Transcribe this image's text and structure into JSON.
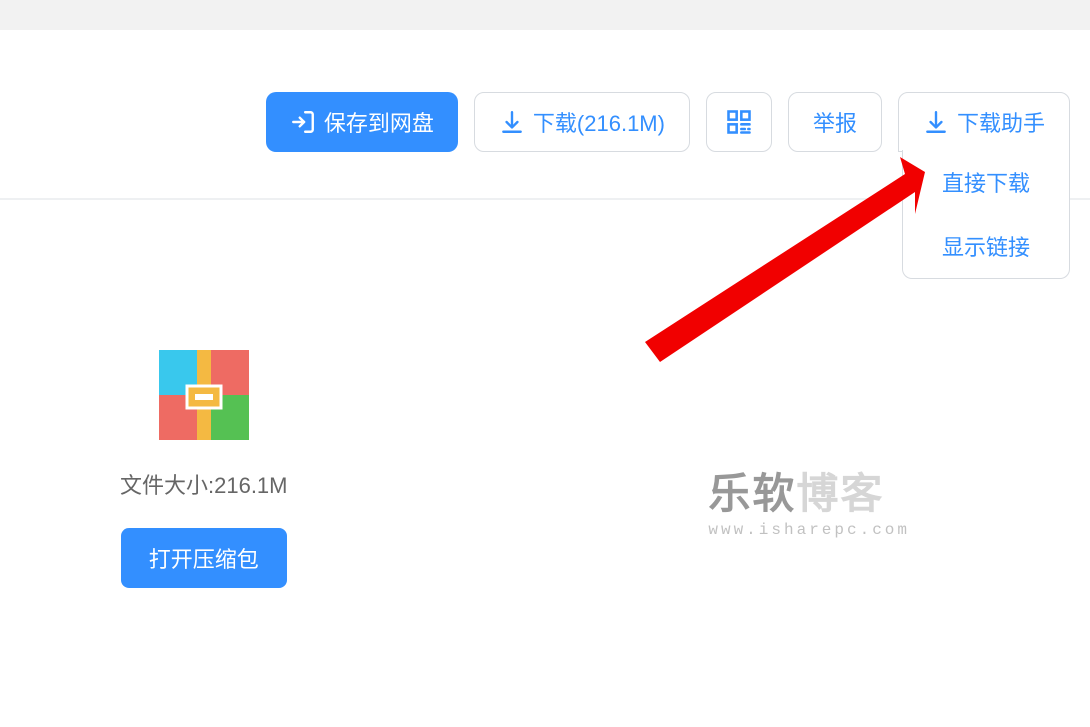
{
  "toolbar": {
    "save": "保存到网盘",
    "download": "下载(216.1M)",
    "report": "举报",
    "helper": "下载助手"
  },
  "dropdown": {
    "direct": "直接下载",
    "showlink": "显示链接"
  },
  "file": {
    "size_label": "文件大小:216.1M",
    "open": "打开压缩包"
  },
  "watermark": {
    "brand": "乐软",
    "blog": "博客",
    "url": "www.isharepc.com"
  }
}
